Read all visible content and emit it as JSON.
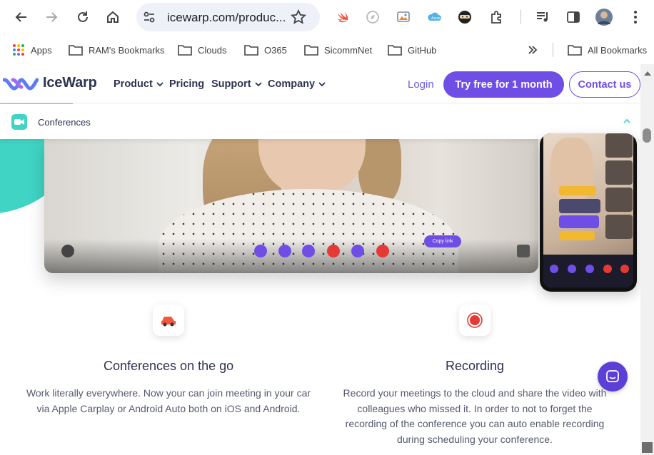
{
  "browser": {
    "url": "icewarp.com/produc...",
    "bookmarks": [
      {
        "label": "Apps",
        "icon": "apps-grid-icon"
      },
      {
        "label": "RAM's Bookmarks",
        "icon": "folder-icon"
      },
      {
        "label": "Clouds",
        "icon": "folder-icon"
      },
      {
        "label": "O365",
        "icon": "folder-icon"
      },
      {
        "label": "SicommNet",
        "icon": "folder-icon"
      },
      {
        "label": "GitHub",
        "icon": "folder-icon"
      }
    ],
    "all_bookmarks": "All Bookmarks"
  },
  "site": {
    "logo_text": "IceWarp",
    "nav": [
      "Product",
      "Pricing",
      "Support",
      "Company"
    ],
    "login": "Login",
    "try_cta": "Try free for 1 month",
    "contact_cta": "Contact us",
    "sub_header": "Conferences"
  },
  "hero": {
    "copy_link": "Copy link"
  },
  "features": [
    {
      "title": "Conferences on the go",
      "description": "Work literally everywhere. Now your can join meeting in your car via Apple Carplay or Android Auto both on iOS and Android.",
      "icon": "car-icon"
    },
    {
      "title": "Recording",
      "description": "Record your meetings to the cloud and share the video with colleagues who missed it. In order to not to forget the recording of the conference you can auto enable recording during scheduling your conference.",
      "icon": "record-icon"
    }
  ],
  "colors": {
    "brand_purple": "#6f4ee6",
    "teal": "#3fd4c3",
    "navy": "#2d3452",
    "record_red": "#e53935"
  }
}
